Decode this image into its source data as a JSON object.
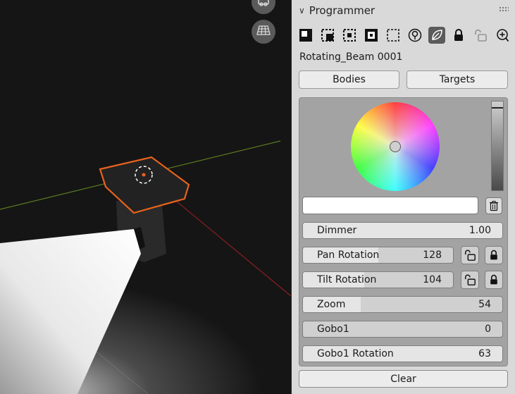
{
  "panel": {
    "title": "Programmer",
    "object_name": "Rotating_Beam 0001",
    "icons": [
      {
        "name": "select-all-icon",
        "active": false
      },
      {
        "name": "select-invert-icon",
        "active": false
      },
      {
        "name": "select-center-icon",
        "active": false
      },
      {
        "name": "select-inside-icon",
        "active": false
      },
      {
        "name": "select-none-icon",
        "active": false
      },
      {
        "name": "light-bulb-icon",
        "active": false
      },
      {
        "name": "leaf-icon",
        "active": true
      },
      {
        "name": "lock-icon",
        "active": false
      },
      {
        "name": "unlock-icon",
        "disabled": true
      },
      {
        "name": "zoom-in-icon",
        "active": false
      }
    ],
    "tabs": {
      "bodies": "Bodies",
      "targets": "Targets"
    },
    "hex_value": "",
    "sliders": {
      "dimmer": {
        "label": "Dimmer",
        "value": "1.00",
        "fill": 1.0
      },
      "pan": {
        "label": "Pan Rotation",
        "value": "128",
        "fill": 0.5
      },
      "tilt": {
        "label": "Tilt Rotation",
        "value": "104",
        "fill": 0.407
      },
      "zoom": {
        "label": "Zoom",
        "value": "54",
        "fill": 0.29
      },
      "gobo1": {
        "label": "Gobo1",
        "value": "0",
        "fill": 0.0
      },
      "gobo1_rotation": {
        "label": "Gobo1 Rotation",
        "value": "63",
        "fill": 1.0
      }
    },
    "clear_label": "Clear"
  },
  "colors": {
    "selection_outline": "#e8621c",
    "x_axis": "#8b1f22",
    "y_axis": "#5b7a20"
  }
}
